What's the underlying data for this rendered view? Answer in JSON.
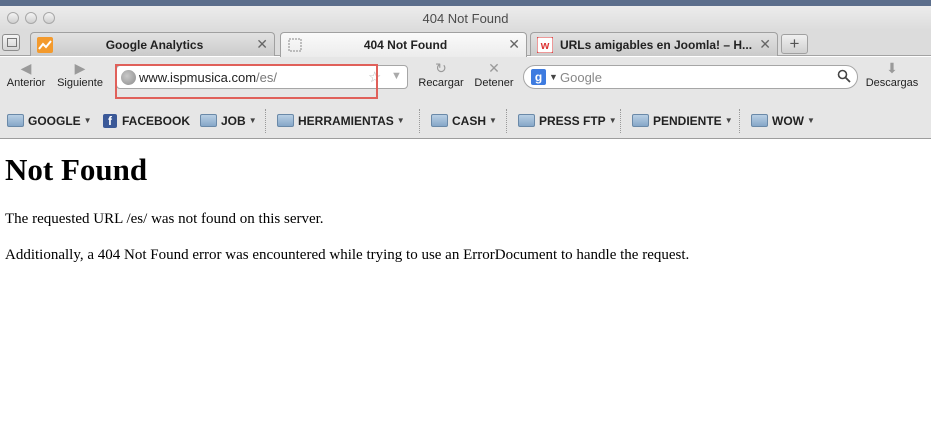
{
  "window": {
    "title": "404 Not Found"
  },
  "tabs": [
    {
      "label": "Google Analytics",
      "icon": "analytics-favicon-icon",
      "active": false
    },
    {
      "label": "404 Not Found",
      "icon": "blank-page-icon",
      "active": true
    },
    {
      "label": "URLs amigables en Joomla! – H...",
      "icon": "w-favicon-icon",
      "active": false
    }
  ],
  "tab_close": "✕",
  "new_tab": "+",
  "nav": {
    "back": "Anterior",
    "forward": "Siguiente",
    "reload": "Recargar",
    "stop": "Detener",
    "downloads": "Descargas"
  },
  "url": {
    "host": "www.ispmusica.com",
    "path": "/es/"
  },
  "search": {
    "placeholder": "Google",
    "engine_letter": "g"
  },
  "bookmarks": [
    {
      "label": "GOOGLE",
      "icon": "folder-icon"
    },
    {
      "label": "FACEBOOK",
      "icon": "facebook-icon"
    },
    {
      "label": "JOB",
      "icon": "folder-icon"
    },
    {
      "label": "HERRAMIENTAS",
      "icon": "folder-icon"
    },
    {
      "label": "CASH",
      "icon": "folder-icon"
    },
    {
      "label": "PRESS FTP",
      "icon": "folder-icon"
    },
    {
      "label": "PENDIENTE",
      "icon": "folder-icon"
    },
    {
      "label": "WOW",
      "icon": "folder-icon"
    }
  ],
  "page": {
    "heading": "Not Found",
    "message": "The requested URL /es/ was not found on this server.",
    "additional": "Additionally, a 404 Not Found error was encountered while trying to use an ErrorDocument to handle the request."
  },
  "colors": {
    "highlight_box": "#e0605a",
    "facebook": "#3b5998",
    "google_logo": "#3d7be0"
  }
}
